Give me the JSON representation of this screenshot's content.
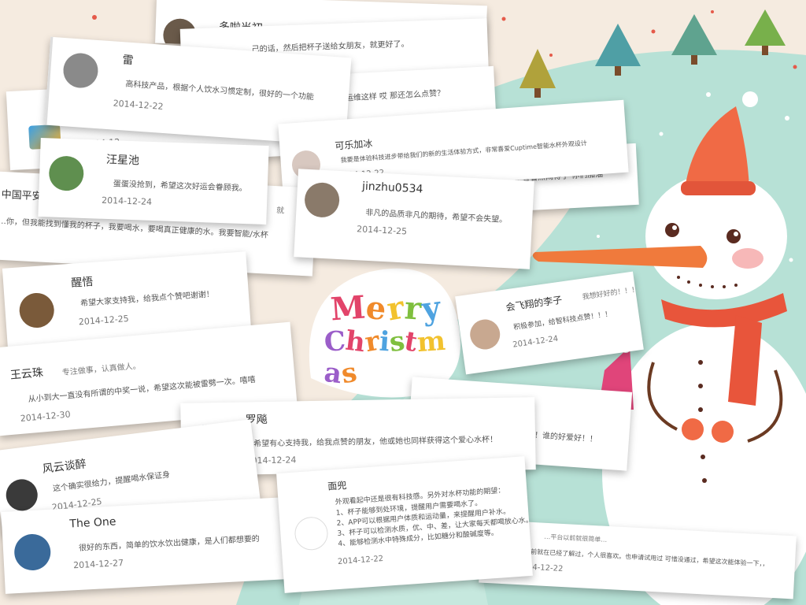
{
  "greeting": {
    "line1": "Merry",
    "line2": "Christmas"
  },
  "colors": {
    "background": "#f5ebe0",
    "snow_hill": "#b7e1d6",
    "tree_green": "#5fa38f",
    "tree_olive": "#b0a23b",
    "hat_red": "#f06a45",
    "scarf_red": "#e8553b",
    "letters": [
      "#e2446a",
      "#f08a2b",
      "#f2c22e",
      "#7fbf3e",
      "#4fa3e0",
      "#9b5ec9",
      "#e2446a",
      "#f08a2b",
      "#4fa3e0",
      "#7fbf3e",
      "#e2446a",
      "#f2c22e",
      "#9b5ec9",
      "#f08a2b"
    ]
  },
  "comments": [
    {
      "name": "多啦当初",
      "text": "",
      "date": "",
      "extra": ""
    },
    {
      "name": "",
      "text": "…己的话，然后把杯子送给女朋友，就更好了。",
      "date": "",
      "extra": ""
    },
    {
      "name": "",
      "text": "…运维这样 哎 那还怎么点赞？",
      "date": "2014-12-",
      "extra": ""
    },
    {
      "name": "雷",
      "text": "高科技产品，根据个人饮水习惯定制，很好的一个功能",
      "date": "2014-12-22",
      "extra": ""
    },
    {
      "name": "可乐加冰",
      "text": "我要是体验科技进步带给我们的新的生活体验方式，非常喜爱Cuptime智能水杯外观设计",
      "date": "2014-12-22",
      "extra": ""
    },
    {
      "name": "汪星池",
      "text": "蛋蛋没抢到，希望这次好运会眷顾我。",
      "date": "2014-12-24",
      "extra": ""
    },
    {
      "name": "jinzhu0534",
      "text": "非凡的品质非凡的期待，希望不会失望。",
      "date": "2014-12-25",
      "extra": ""
    },
    {
      "name": "",
      "text": "…问题 我就是看看热闹得了 你们加油",
      "date": "",
      "extra": ""
    },
    {
      "name": "中国平安",
      "text": "…你，但我能找到懂我的杯子，我要喝水，要喝真正健康的水。我要智能/水杯",
      "date": "",
      "extra": "就"
    },
    {
      "name": "醒悟",
      "text": "希望大家支持我，给我点个赞吧谢谢！",
      "date": "2014-12-25",
      "extra": ""
    },
    {
      "name": "会飞翔的李子",
      "text": "积极参加，给智科技点赞！！！",
      "date": "2014-12-24",
      "extra": "我想好好的！！！"
    },
    {
      "name": "王云珠",
      "text": "从小到大一直没有所谓的中奖一说，希望这次能被雷劈一次。嘻嘻",
      "date": "2014-12-30",
      "extra": "专注做事，认真做人。"
    },
    {
      "name": "罗飚",
      "text": "希望有心支持我，给我点赞的朋友，他或她也同样获得这个爱心水杯！",
      "date": "2014-12-24",
      "extra": ""
    },
    {
      "name": "",
      "text": "…多赞！谁的好爱好！！",
      "date": "",
      "extra": ""
    },
    {
      "name": "风云谈醉",
      "text": "这个确实很给力，提醒喝水保证身",
      "date": "2014-12-25",
      "extra": ""
    },
    {
      "name": "The One",
      "text": "很好的东西，简单的饮水饮出健康，是人们都想要的",
      "date": "2014-12-27",
      "extra": ""
    },
    {
      "name": "面兜",
      "text": "外观看起中还是很有科技感。另外对水杯功能的期望：",
      "date": "2014-12-22",
      "extra": "",
      "list": [
        "1、杯子能够到处环境，提醒用户需要喝水了。",
        "2、APP可以根据用户体质和运动量，来提醒用户补水。",
        "3、杯子可以检测水质，优、中、差，让大家每天都喝放心水。",
        "4、能够检测水中特殊成分，比如糖分和酸碱度等。"
      ]
    },
    {
      "name": "",
      "text": "…都之前就在已经了解过，个人很喜欢。也申请试用过 可惜没通过，希望这次能体验一下，，",
      "date": "2014-12-22",
      "extra": "…平台以前就很简单…"
    }
  ]
}
